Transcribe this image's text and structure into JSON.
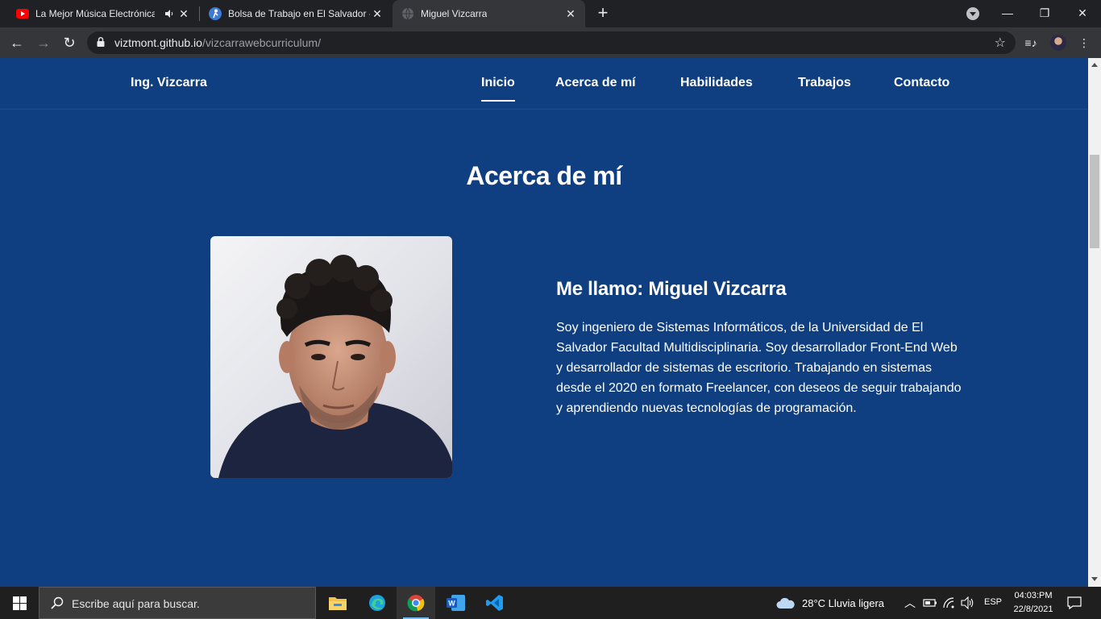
{
  "browser": {
    "tabs": [
      {
        "title": "La Mejor Música Electrónica",
        "favicon": "youtube-icon",
        "audio": "speaker-icon"
      },
      {
        "title": "Bolsa de Trabajo en El Salvador -",
        "favicon": "job-board-icon"
      },
      {
        "title": "Miguel Vizcarra",
        "favicon": "globe-icon",
        "active": true
      }
    ],
    "url_host": "viztmont.github.io",
    "url_path": "/vizcarrawebcurriculum/"
  },
  "site": {
    "brand": "Ing. Vizcarra",
    "nav": [
      "Inicio",
      "Acerca de mí",
      "Habilidades",
      "Trabajos",
      "Contacto"
    ],
    "active_nav": "Inicio"
  },
  "about": {
    "title": "Acerca de mí",
    "heading": "Me llamo: Miguel Vizcarra",
    "text": "Soy ingeniero de Sistemas Informáticos, de la Universidad de El Salvador Facultad Multidisciplinaria. Soy desarrollador Front-End Web y desarrollador de sistemas de escritorio. Trabajando en sistemas desde el 2020 en formato Freelancer, con deseos de seguir trabajando y aprendiendo nuevas tecnologías de programación.",
    "photo": "profile-photo"
  },
  "taskbar": {
    "search_placeholder": "Escribe aquí para buscar.",
    "apps": [
      "file-explorer-icon",
      "edge-icon",
      "chrome-icon",
      "word-icon",
      "vscode-icon"
    ],
    "weather": "28°C  Lluvia ligera",
    "language": "ESP",
    "time": "04:03:PM",
    "date": "22/8/2021"
  },
  "colors": {
    "page_bg": "#0f3f80",
    "tabbar_bg": "#202124",
    "toolbar_bg": "#35363a"
  }
}
